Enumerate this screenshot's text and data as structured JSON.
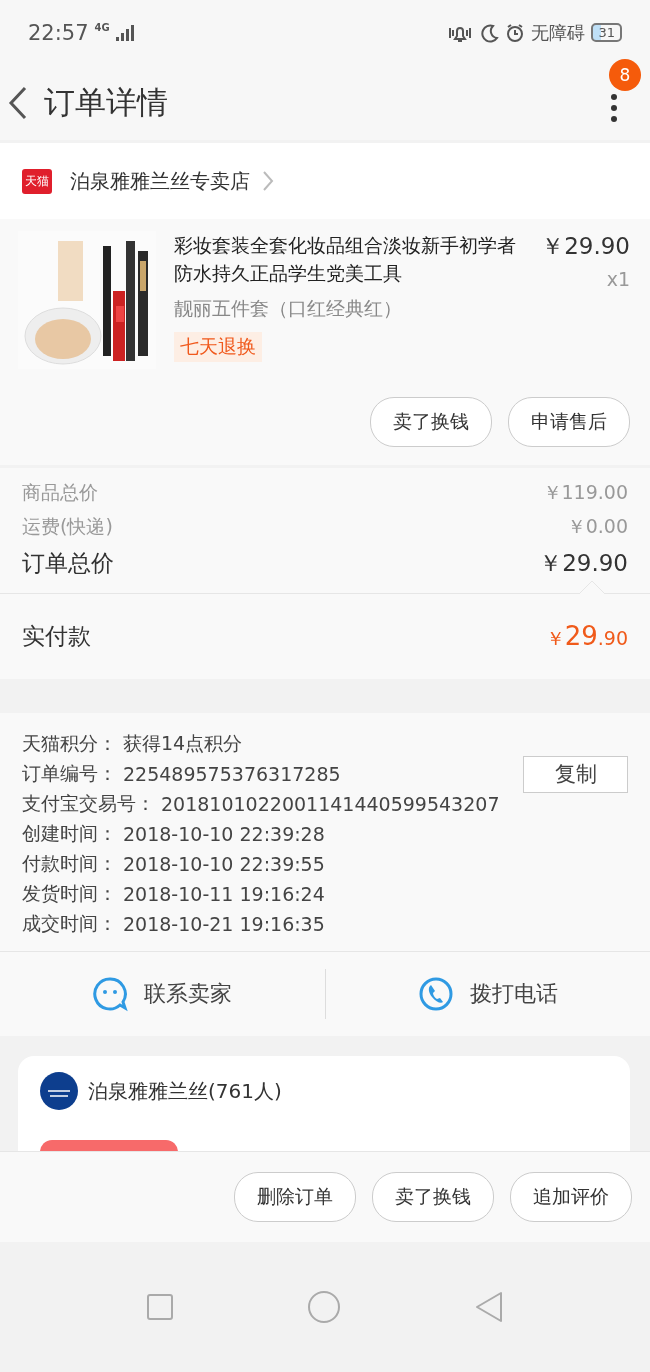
{
  "status_bar": {
    "time": "22:57",
    "network": "4G",
    "accessibility": "无障碍",
    "battery": "31"
  },
  "header": {
    "title": "订单详情",
    "badge": "8"
  },
  "store": {
    "badge": "天猫",
    "name": "泊泉雅雅兰丝专卖店"
  },
  "product": {
    "title": "彩妆套装全套化妆品组合淡妆新手初学者防水持久正品学生党美工具",
    "variant": "靓丽五件套（口红经典红）",
    "tag": "七天退换",
    "price": "￥29.90",
    "quantity": "x1",
    "actions": [
      "卖了换钱",
      "申请售后"
    ]
  },
  "summary": [
    {
      "label": "商品总价",
      "value": "￥119.00",
      "kind": "minor"
    },
    {
      "label": "运费(快递)",
      "value": "￥0.00",
      "kind": "minor"
    },
    {
      "label": "订单总价",
      "value": "￥29.90",
      "kind": "major"
    }
  ],
  "paid": {
    "label": "实付款",
    "currency": "￥",
    "integer": "29",
    "decimals": ".90"
  },
  "info": [
    {
      "label": "天猫积分：",
      "value": "获得14点积分"
    },
    {
      "label": "订单编号：",
      "value": "225489575376317285",
      "button": "复制"
    },
    {
      "label": "支付宝交易号：",
      "value": "2018101022001141440599543207"
    },
    {
      "label": "创建时间：",
      "value": "2018-10-10 22:39:28"
    },
    {
      "label": "付款时间：",
      "value": "2018-10-10 22:39:55"
    },
    {
      "label": "发货时间：",
      "value": "2018-10-11 19:16:24"
    },
    {
      "label": "成交时间：",
      "value": "2018-10-21 19:16:35"
    }
  ],
  "contacts": [
    {
      "label": "联系卖家",
      "kind": "chat"
    },
    {
      "label": "拨打电话",
      "kind": "phone"
    }
  ],
  "group": {
    "name": "泊泉雅雅兰丝(761人)"
  },
  "bottom_actions": [
    "删除订单",
    "卖了换钱",
    "追加评价"
  ]
}
